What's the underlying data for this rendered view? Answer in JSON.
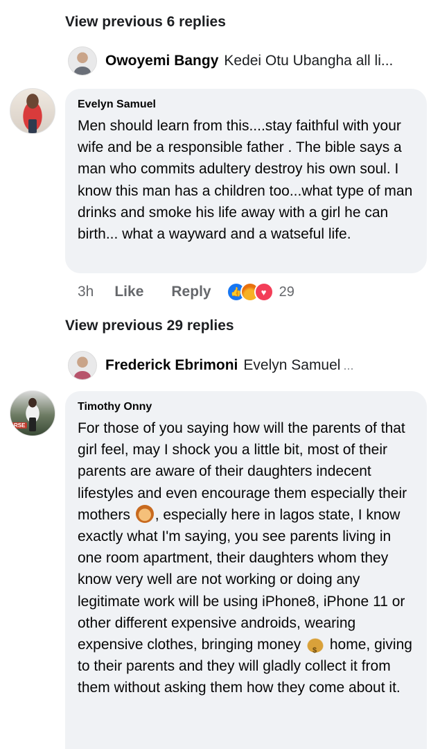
{
  "thread1": {
    "view_previous": "View previous 6 replies",
    "reply": {
      "name": "Owoyemi Bangy",
      "snippet": "Kedei Otu Ubangha all li...",
      "ellipsis": ""
    }
  },
  "comment1": {
    "author": "Evelyn Samuel",
    "text": "Men should learn from this....stay faithful with your wife and be a responsible father . The bible says  a man who commits adultery destroy his own soul. I know this man has a children too...what type of man drinks and smoke his life away with a girl he can birth... what a wayward and a watseful life.",
    "time": "3h",
    "like_label": "Like",
    "reply_label": "Reply",
    "reaction_count": "29",
    "reactions": [
      "like-icon",
      "angry-icon",
      "love-icon"
    ]
  },
  "thread2": {
    "view_previous": "View previous 29 replies",
    "reply": {
      "name": "Frederick Ebrimoni",
      "snippet": "Evelyn Samuel",
      "ellipsis": "..."
    }
  },
  "comment2": {
    "author": "Timothy Onny",
    "avatar_badge": "RSE",
    "text_part1": "For those of you saying how will the parents of that girl feel, may I shock you a little bit, most of their parents are aware of their daughters indecent lifestyles and even encourage them especially their mothers",
    "emoji1": "woman-emoji",
    "text_part2": ", especially here in lagos state, I know exactly what I'm saying, you see parents living in one room apartment, their daughters whom they know very well are not working or doing any legitimate work will be using iPhone8, iPhone 11 or other different expensive androids, wearing expensive clothes, bringing money",
    "emoji2": "money-bag-emoji",
    "text_part3": " home, giving to their parents and they will gladly collect it from them without asking them how they come about it."
  }
}
